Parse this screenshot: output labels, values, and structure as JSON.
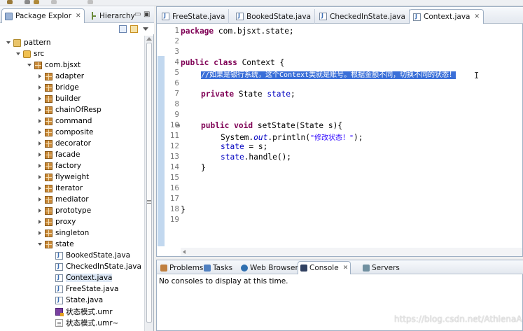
{
  "left_view": {
    "tabs": [
      {
        "label": "Package Explor",
        "icon": "package-explorer-icon"
      },
      {
        "label": "Hierarchy",
        "icon": "hierarchy-icon"
      }
    ],
    "tree": [
      {
        "label": "pattern",
        "icon": "project-icon",
        "level": 0,
        "expanded": true
      },
      {
        "label": "src",
        "icon": "source-folder-icon",
        "level": 1,
        "expanded": true
      },
      {
        "label": "com.bjsxt",
        "icon": "package-icon",
        "level": 2,
        "expanded": true
      },
      {
        "label": "adapter",
        "icon": "package-icon",
        "level": 3
      },
      {
        "label": "bridge",
        "icon": "package-icon",
        "level": 3
      },
      {
        "label": "builder",
        "icon": "package-icon",
        "level": 3
      },
      {
        "label": "chainOfResp",
        "icon": "package-icon",
        "level": 3
      },
      {
        "label": "command",
        "icon": "package-icon",
        "level": 3
      },
      {
        "label": "composite",
        "icon": "package-icon",
        "level": 3
      },
      {
        "label": "decorator",
        "icon": "package-icon",
        "level": 3
      },
      {
        "label": "facade",
        "icon": "package-icon",
        "level": 3
      },
      {
        "label": "factory",
        "icon": "package-icon",
        "level": 3
      },
      {
        "label": "flyweight",
        "icon": "package-icon",
        "level": 3
      },
      {
        "label": "iterator",
        "icon": "package-icon",
        "level": 3
      },
      {
        "label": "mediator",
        "icon": "package-icon",
        "level": 3
      },
      {
        "label": "prototype",
        "icon": "package-icon",
        "level": 3
      },
      {
        "label": "proxy",
        "icon": "package-icon",
        "level": 3
      },
      {
        "label": "singleton",
        "icon": "package-icon",
        "level": 3
      },
      {
        "label": "state",
        "icon": "package-icon",
        "level": 3,
        "expanded": true
      },
      {
        "label": "BookedState.java",
        "icon": "java-file-icon",
        "level": 4
      },
      {
        "label": "CheckedInState.java",
        "icon": "java-file-icon",
        "level": 4
      },
      {
        "label": "Context.java",
        "icon": "java-file-icon",
        "level": 4,
        "selected": true
      },
      {
        "label": "FreeState.java",
        "icon": "java-file-icon",
        "level": 4
      },
      {
        "label": "State.java",
        "icon": "java-file-icon",
        "level": 4
      },
      {
        "label": "状态模式.umr",
        "icon": "umr-file-icon",
        "level": 4
      },
      {
        "label": "状态模式.umr~",
        "icon": "text-file-icon",
        "level": 4
      }
    ]
  },
  "editor": {
    "tabs": [
      {
        "label": "FreeState.java"
      },
      {
        "label": "BookedState.java"
      },
      {
        "label": "CheckedInState.java"
      },
      {
        "label": "Context.java",
        "active": true
      }
    ],
    "line_numbers": [
      "1",
      "2",
      "3",
      "4",
      "5",
      "6",
      "7",
      "8",
      "9",
      "10",
      "11",
      "12",
      "13",
      "14",
      "15",
      "16",
      "17",
      "18",
      "19"
    ],
    "code": {
      "l1_kw": "package",
      "l1_rest": " com.bjsxt.state;",
      "l4_kw": "public class",
      "l4_rest": " Context {",
      "l5_comment": "//如果是银行系统，这个Context类就是账号。根据金额不同，切换不同的状态！",
      "l7_kw": "private",
      "l7_type": " State ",
      "l7_field": "state",
      "l7_end": ";",
      "l10_kw": "public void",
      "l10_rest": " setState(State s){",
      "l11_a": "System.",
      "l11_out": "out",
      "l11_b": ".println(",
      "l11_str": "\"修改状态！\"",
      "l11_c": ");",
      "l12_field": "state",
      "l12_rest": " = s;",
      "l13_field": "state",
      "l13_rest": ".handle();",
      "l14": "}",
      "l18": "}"
    }
  },
  "bottom_view": {
    "tabs": [
      {
        "label": "Problems",
        "color": "#c08040"
      },
      {
        "label": "Tasks",
        "color": "#5080c0"
      },
      {
        "label": "Web Browser",
        "color": "#3070b0"
      },
      {
        "label": "Console",
        "color": "#304060",
        "active": true
      },
      {
        "label": "Servers",
        "color": "#7090a0"
      }
    ],
    "message": "No consoles to display at this time."
  },
  "watermark": "https://blog.csdn.net/AthlenaA"
}
